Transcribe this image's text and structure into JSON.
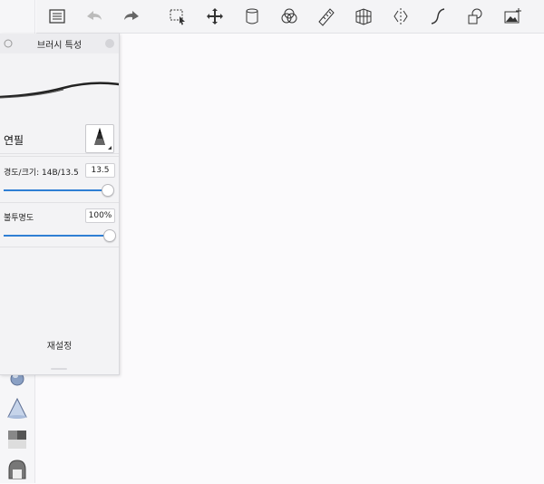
{
  "panel": {
    "title": "브러시 특성",
    "brush_name": "연필",
    "hardness_label": "경도/크기: 14B/13.5",
    "hardness_value": "13.5",
    "hardness_level": 0.98,
    "opacity_label": "불투명도",
    "opacity_value": "100%",
    "opacity_level": 1.0,
    "reset_label": "재설정"
  },
  "toolbar": {
    "icons": [
      "list-icon",
      "undo-icon",
      "redo-icon",
      "selection-icon",
      "move-icon",
      "layer-icon",
      "blend-icon",
      "ruler-icon",
      "perspective-grid-icon",
      "symmetry-icon",
      "curve-icon",
      "shapes-icon",
      "image-add-icon"
    ]
  },
  "colors": {
    "accent": "#2f7fd4",
    "panel_bg": "#f3f3f5",
    "canvas_bg": "#fbfafc"
  }
}
